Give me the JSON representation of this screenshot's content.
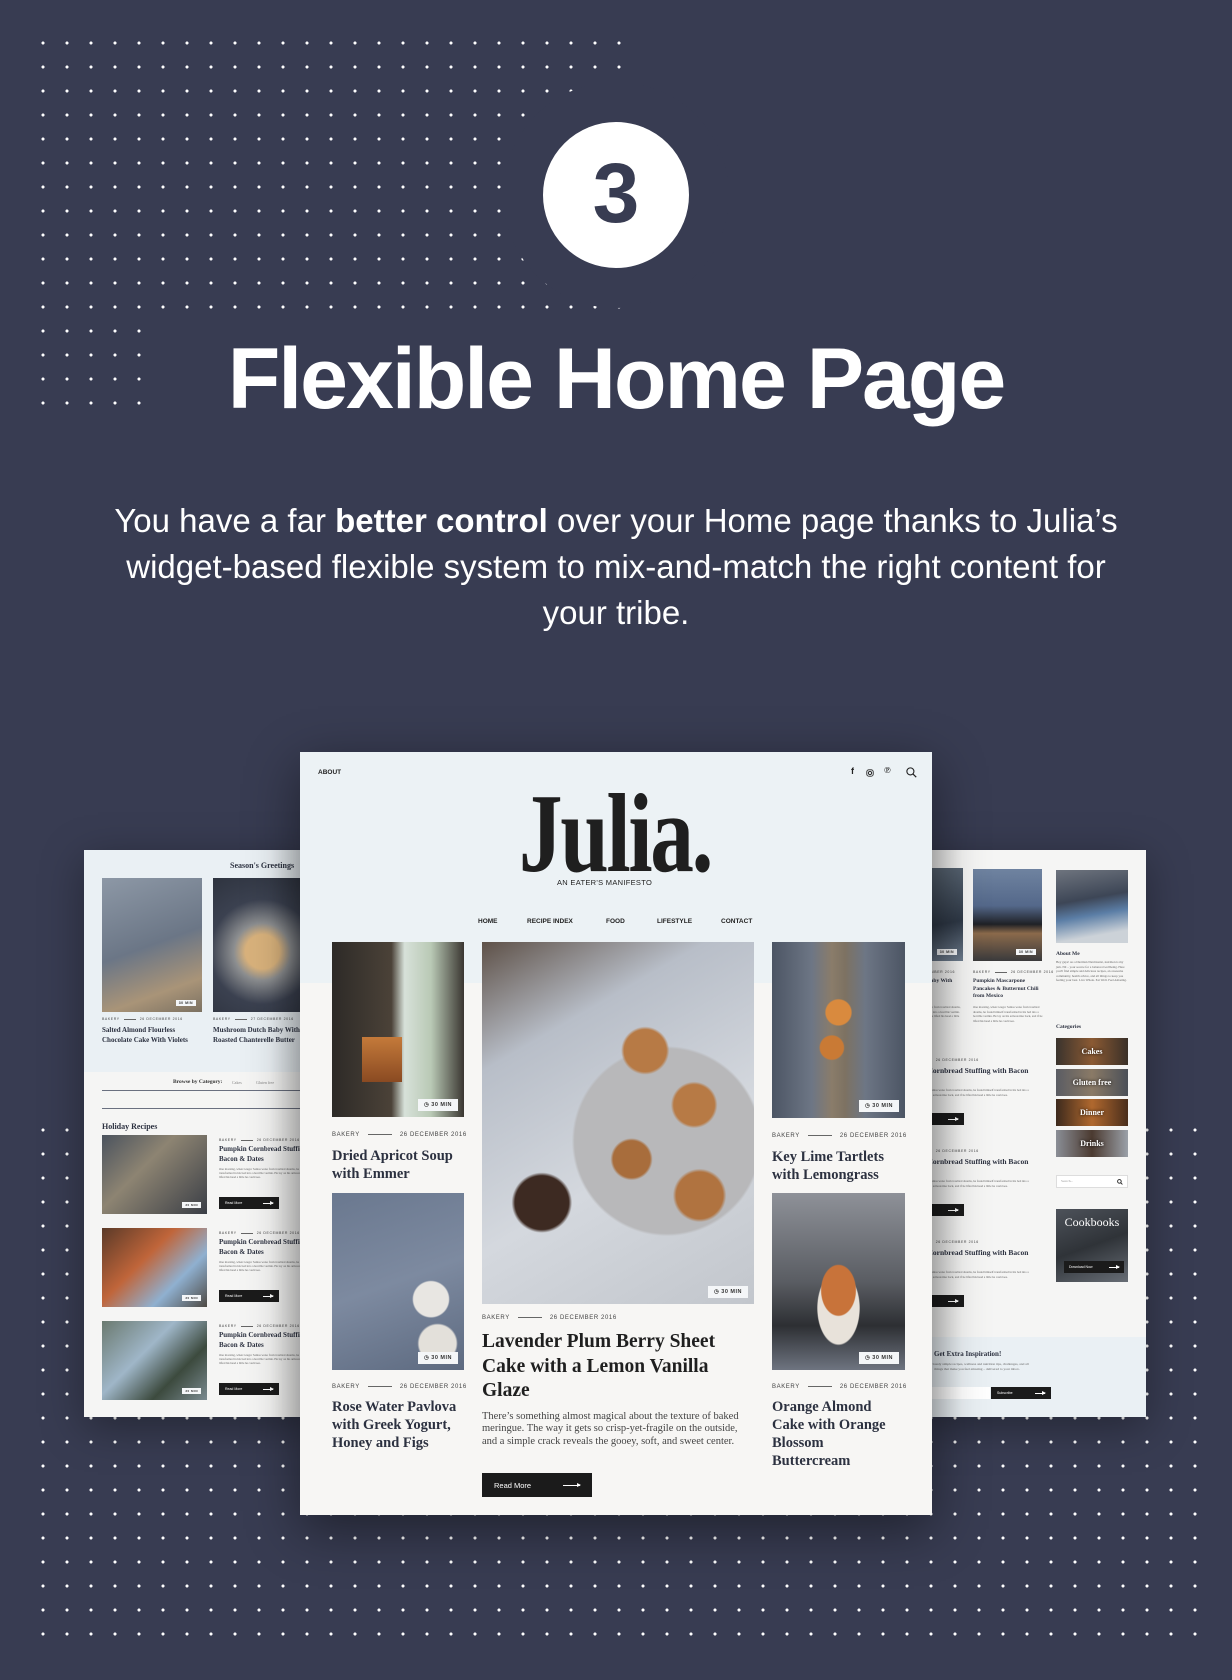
{
  "hero": {
    "step_number": "3",
    "title": "Flexible Home Page",
    "subtitle_pre": "You have a far ",
    "subtitle_bold": "better control",
    "subtitle_post": " over your Home page thanks to Julia’s widget-based flexible system to mix-and-match the right content for your tribe.",
    "background_color": "#383c52"
  },
  "main": {
    "top_link": "ABOUT",
    "social_icons": [
      "facebook-icon",
      "instagram-icon",
      "pinterest-icon",
      "search-icon"
    ],
    "logo": "Julia.",
    "tagline": "AN EATER'S MANIFESTO",
    "nav": [
      "HOME",
      "RECIPE INDEX",
      "FOOD",
      "LIFESTYLE",
      "CONTACT"
    ],
    "time_badge": "30 MIN",
    "left": [
      {
        "category": "BAKERY",
        "date": "26 DECEMBER 2016",
        "title": "Dried Apricot Soup with Emmer"
      },
      {
        "category": "BAKERY",
        "date": "26 DECEMBER 2016",
        "title": "Rose Water Pavlova with Greek Yogurt, Honey and Figs"
      }
    ],
    "featured": {
      "category": "BAKERY",
      "date": "26 DECEMBER 2016",
      "title": "Lavender Plum Berry Sheet Cake with a Lemon Vanilla Glaze",
      "excerpt": "There’s something almost magical about the texture of baked meringue. The way it gets so crisp-yet-fragile on the outside, and a simple crack reveals the gooey, soft, and sweet center.",
      "button": "Read More"
    },
    "right": [
      {
        "category": "BAKERY",
        "date": "26 DECEMBER 2016",
        "title": "Key Lime Tartlets with Lemongrass"
      },
      {
        "category": "BAKERY",
        "date": "26 DECEMBER 2016",
        "title": "Orange Almond Cake with Orange Blossom Buttercream"
      }
    ]
  },
  "left_panel": {
    "section_title": "Season's Greetings",
    "cards": [
      {
        "category": "BAKERY",
        "date": "26 DECEMBER 2016",
        "title": "Salted Almond Flourless Chocolate Cake With Violets"
      },
      {
        "category": "BAKERY",
        "date": "27 DECEMBER 2016",
        "title": "Mushroom Dutch Baby With Roasted Chanterelle Butter"
      }
    ],
    "browse_label": "Browse by Category:",
    "browse_items": [
      "Cakes",
      "Gluten free"
    ],
    "list_title": "Holiday Recipes",
    "list": [
      {
        "category": "BAKERY",
        "date": "26 DECEMBER 2016",
        "title": "Pumpkin Cornbread Stuffing with Bacon & Dates",
        "excerpt": "One morning, when Gregor Samsa woke from troubled dreams, he found himself transformed in his bed into a horrible vermin. He lay on his armour-like back, and if he lifted his head a little he could see.",
        "button": "Read More"
      },
      {
        "category": "BAKERY",
        "date": "26 DECEMBER 2016",
        "title": "Pumpkin Cornbread Stuffing with Bacon & Dates",
        "excerpt": "One morning, when Gregor Samsa woke from troubled dreams, he found himself transformed in his bed into a horrible vermin. He lay on his armour-like back, and if he lifted his head a little he could see.",
        "button": "Read More"
      },
      {
        "category": "BAKERY",
        "date": "26 DECEMBER 2016",
        "title": "Pumpkin Cornbread Stuffing with Bacon & Dates",
        "excerpt": "One morning, when Gregor Samsa woke from troubled dreams, he found himself transformed in his bed into a horrible vermin. He lay on his armour-like back, and if he lifted his head a little he could see.",
        "button": "Read More"
      }
    ]
  },
  "right_panel": {
    "cards": [
      {
        "date": "26 DECEMBER 2016",
        "title": "Mushroom Dutch Baby With Roasted Chanterelle",
        "excerpt": "One morning, when Gregor Samsa woke from troubled dreams, he found himself transformed in his bed into a horrible vermin. He lay on his armour-like back, and if he lifted his head a little he could see."
      },
      {
        "category": "BAKERY",
        "date": "26 DECEMBER 2016",
        "title": "Pumpkin Mascarpone Pancakes & Butternut Chili from Mexico",
        "excerpt": "One morning, when Gregor Samsa woke from troubled dreams, he found himself transformed in his bed into a horrible vermin. He lay on his armour-like back, and if he lifted his head a little he could see."
      }
    ],
    "list": [
      {
        "category": "BAKERY",
        "date": "26 DECEMBER 2016",
        "title": "Pumpkin Cornbread Stuffing with Bacon & Dates",
        "excerpt": "One morning, when Gregor Samsa woke from troubled dreams, he found himself transformed in his bed into a horrible vermin. He lay on his armour-like back, and if he lifted his head a little he could see.",
        "button": "Read More"
      },
      {
        "category": "BAKERY",
        "date": "26 DECEMBER 2016",
        "title": "Pumpkin Cornbread Stuffing with Bacon & Dates",
        "excerpt": "One morning, when Gregor Samsa woke from troubled dreams, he found himself transformed in his bed into a horrible vermin. He lay on his armour-like back, and if he lifted his head a little he could see.",
        "button": "Read More"
      },
      {
        "category": "BAKERY",
        "date": "26 DECEMBER 2016",
        "title": "Pumpkin Cornbread Stuffing with Bacon & Dates",
        "excerpt": "One morning, when Gregor Samsa woke from troubled dreams, he found himself transformed in his bed into a horrible vermin. He lay on his armour-like back, and if he lifted his head a little he could see.",
        "button": "Read More"
      }
    ],
    "about_title": "About Me",
    "about_text": "Hey guys! As a Dietitian Nutritionist, nutrition is my jam. Nil – your source for a balanced wellbeing. Here you'll find simple and delicious recipes, an awesome community, health advice, and all things to keep you feeling your best. Live Whole. Eat Well. Feel Amazing.",
    "categories_title": "Categories",
    "categories": [
      "Cakes",
      "Gluten free",
      "Dinner",
      "Drinks"
    ],
    "search_placeholder": "Search...",
    "cookbooks_title": "Cookbooks",
    "cookbooks_button": "Download Now",
    "newsletter_title": "Get Extra Inspiration!",
    "newsletter_text": "Deliciously simple recipes, wellness and nutrition tips, challenges, and all things that make you feel amazing – delivered to your inbox.",
    "subscribe_button": "Subscribe"
  }
}
